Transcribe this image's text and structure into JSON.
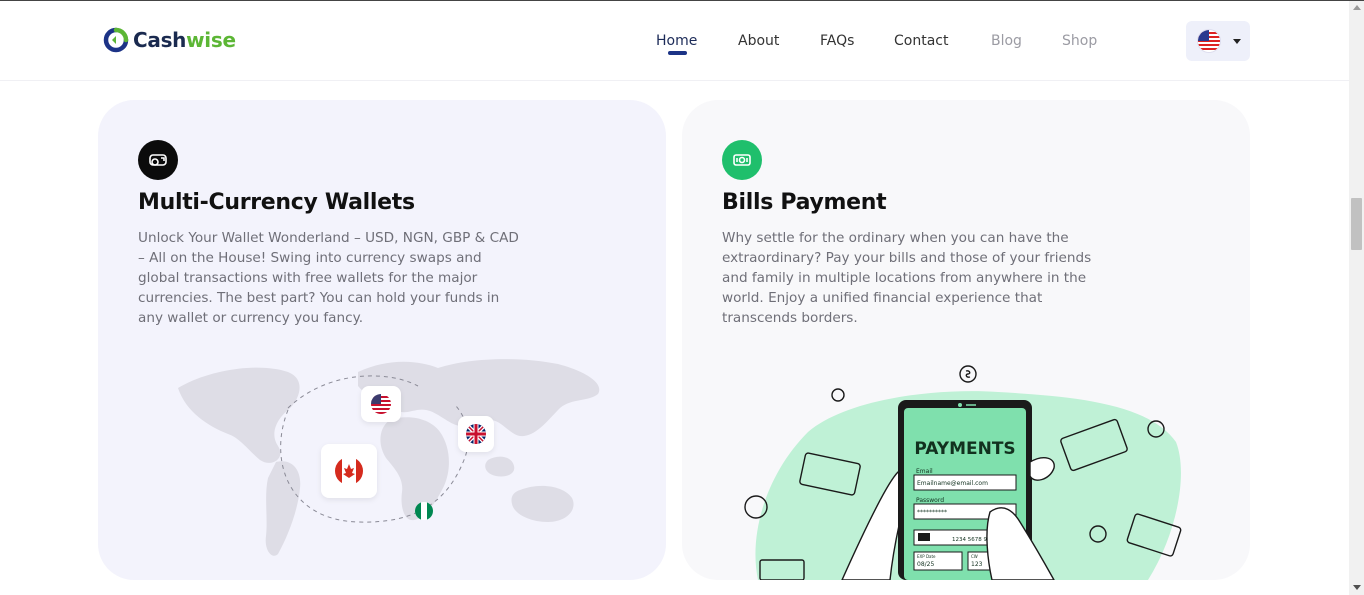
{
  "brand": {
    "name_part1": "Cash",
    "name_part2": "wise"
  },
  "nav": {
    "items": [
      {
        "label": "Home",
        "state": "active"
      },
      {
        "label": "About",
        "state": "normal"
      },
      {
        "label": "FAQs",
        "state": "normal"
      },
      {
        "label": "Contact",
        "state": "normal"
      },
      {
        "label": "Blog",
        "state": "muted"
      },
      {
        "label": "Shop",
        "state": "muted"
      }
    ],
    "language_flag": "us-flag-icon"
  },
  "cards": [
    {
      "icon": "wallet-coins-icon",
      "icon_color": "#0b0b0b",
      "title": "Multi-Currency Wallets",
      "description": "Unlock Your Wallet Wonderland – USD, NGN, GBP & CAD – All on the House! Swing into currency swaps and global transactions with free wallets for the major currencies. The best part? You can hold your funds in any wallet or currency you fancy.",
      "illustration": {
        "type": "world-map",
        "flags": [
          "us-flag-icon",
          "uk-flag-icon",
          "canada-flag-icon",
          "nigeria-flag-icon"
        ]
      }
    },
    {
      "icon": "banknote-icon",
      "icon_color": "#1fbf6c",
      "title": "Bills Payment",
      "description": "Why settle for the ordinary when you can have the extraordinary? Pay your bills and those of your friends and family in multiple locations from anywhere in the world. Enjoy a unified financial experience that transcends borders.",
      "illustration": {
        "type": "phone-payment",
        "screen_title": "PAYMENTS",
        "email_label": "Email",
        "email_value": "Emailname@email.com",
        "password_label": "Password",
        "password_value": "**********",
        "card_number": "1234 5678 910",
        "exp_label": "EXP Date",
        "exp_value": "08/25",
        "cvv_label": "CW",
        "cvv_value": "123"
      }
    }
  ],
  "colors": {
    "accent": "#1c3386",
    "green": "#5cb635",
    "mint": "#bff1d6"
  }
}
